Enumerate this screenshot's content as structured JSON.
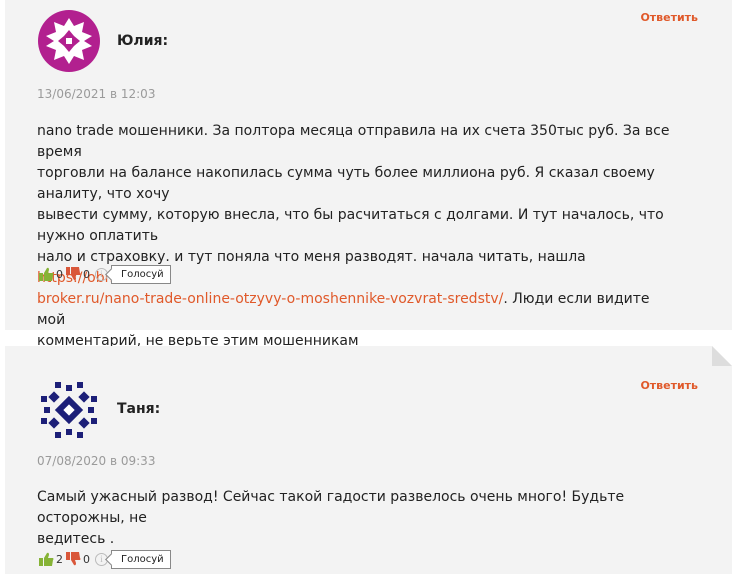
{
  "comments": [
    {
      "author": "Юлия:",
      "reply_label": "Ответить",
      "date": "13/06/2021 в 12:03",
      "text_lines": [
        "nano trade мошенники. За полтора месяца отправила на их счета 350тыс руб. За все время",
        "торговли на балансе накопилась сумма чуть более миллиона руб. Я сказал своему аналиту, что хочу",
        "вывести сумму, которую внесла, что бы расчитаться с долгами. И тут началось, что нужно оплатить",
        "нало и страховку. и тут поняла что меня разводят. начала читать, нашла "
      ],
      "link_part1": "https://obmanul-",
      "link_part2": "broker.ru/nano-trade-online-otzyvy-o-moshennike-vozvrat-sredstv/",
      "after_link": ". Люди если видите мой",
      "last_line": "комментарий, не верьте этим мошенникам",
      "likes": "0",
      "dislikes": "0",
      "info_icon": "i",
      "vote_label": "Голосуй"
    },
    {
      "author": "Таня:",
      "reply_label": "Ответить",
      "date": "07/08/2020 в 09:33",
      "text_lines": [
        "Самый ужасный развод! Сейчас такой гадости развелось очень много! Будьте осторожны, не",
        "ведитесь ."
      ],
      "likes": "2",
      "dislikes": "0",
      "info_icon": "i",
      "vote_label": "Голосуй"
    }
  ],
  "colors": {
    "accent": "#e0592a",
    "avatar1": "#b2208f",
    "avatar2": "#1c1f78",
    "like": "#86b336",
    "dislike": "#d9573a"
  }
}
